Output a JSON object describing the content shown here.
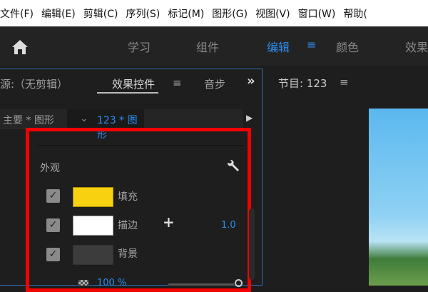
{
  "menu": [
    "文件(F)",
    "编辑(E)",
    "剪辑(C)",
    "序列(S)",
    "标记(M)",
    "图形(G)",
    "视图(V)",
    "窗口(W)",
    "帮助("
  ],
  "workspaces": {
    "learn": "学习",
    "assembly": "组件",
    "editing": "编辑",
    "menu_icon": "≡",
    "color": "颜色",
    "effects": "效果"
  },
  "left_panel": {
    "source_tab": "源:（无剪辑）",
    "effect_controls_tab": "效果控件",
    "menu_icon": "≡",
    "audio_tab": "音步",
    "overflow": "»",
    "clip_master": "主要 * 图形",
    "clip_chevron": "⌄",
    "clip_current": "123 * 图形",
    "play": "▶",
    "section": "外观",
    "rows": [
      {
        "label": "填充",
        "color": "#f8d210"
      },
      {
        "label": "描边",
        "color": "#ffffff",
        "plus": "+",
        "value": "1.0"
      },
      {
        "label": "背景",
        "color": "#3c3c3c"
      }
    ],
    "opacity": "100 %"
  },
  "program": {
    "title": "节目: 123",
    "menu_icon": "≡"
  }
}
